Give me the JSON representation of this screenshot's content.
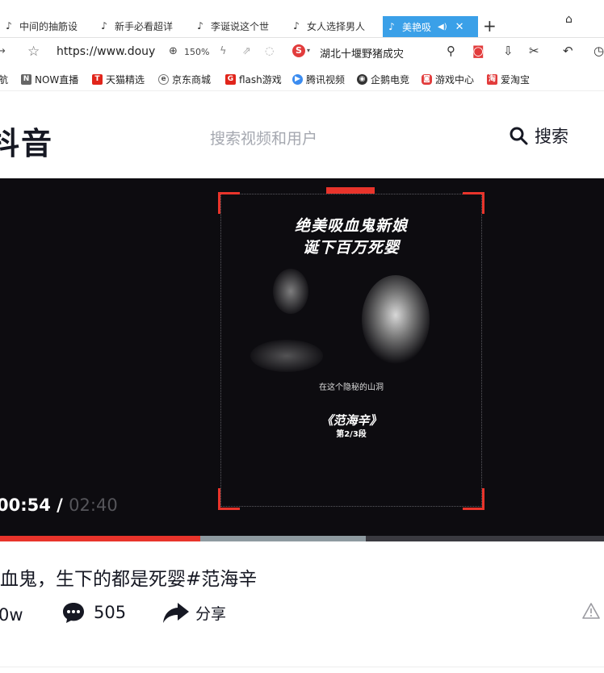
{
  "tabs": [
    {
      "label": "中间的抽筋设"
    },
    {
      "label": "新手必看超详"
    },
    {
      "label": "李诞说这个世"
    },
    {
      "label": "女人选择男人"
    },
    {
      "label": "美艳吸"
    }
  ],
  "new_tab_symbol": "+",
  "address": {
    "url": "https://www.douy",
    "zoom": "150%",
    "search_text": "湖北十堰野猪成灾"
  },
  "bookmarks": [
    {
      "label": "航",
      "color": "#4a8fe0"
    },
    {
      "label": "NOW直播",
      "color": "#666666"
    },
    {
      "label": "天猫精选",
      "color": "#e1251b"
    },
    {
      "label": "京东商城",
      "color": "#555555"
    },
    {
      "label": "flash游戏",
      "color": "#e1251b"
    },
    {
      "label": "腾讯视频",
      "color": "#3b8cf0"
    },
    {
      "label": "企鹅电竞",
      "color": "#333333"
    },
    {
      "label": "游戏中心",
      "color": "#e23c3c"
    },
    {
      "label": "爱淘宝",
      "color": "#e23c3c"
    }
  ],
  "site": {
    "logo_text": "抖音",
    "search_placeholder": "搜索视频和用户",
    "search_button": "搜索"
  },
  "video": {
    "headline_line1": "绝美吸血鬼新娘",
    "headline_line2": "诞下百万死婴",
    "small_caption": "在这个隐秘的山洞",
    "series_title": "《范海辛》",
    "episode": "第2/3段",
    "time_current": "00:54",
    "time_separator": "/",
    "time_total": "02:40",
    "progress_played": 0.331,
    "progress_buffered": 0.606,
    "accent_color": "#e8342b"
  },
  "post": {
    "title": "血鬼，生下的都是死婴#范海辛",
    "likes": "0w",
    "comments": "505",
    "share_label": "分享"
  }
}
